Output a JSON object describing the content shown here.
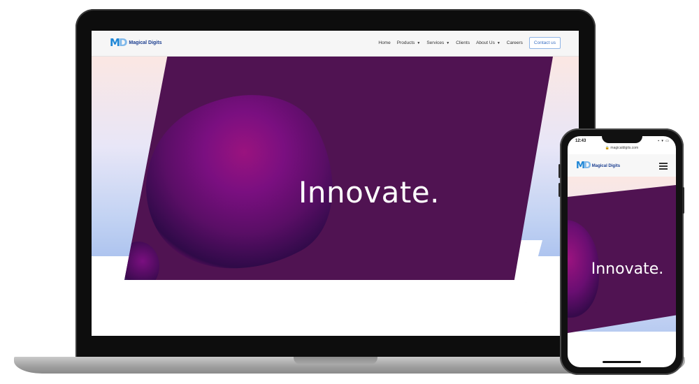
{
  "desktop": {
    "logo": {
      "mark_m": "M",
      "mark_d": "D",
      "text": "Magical Digits"
    },
    "nav": [
      {
        "label": "Home",
        "dropdown": false
      },
      {
        "label": "Products",
        "dropdown": true
      },
      {
        "label": "Services",
        "dropdown": true
      },
      {
        "label": "Clients",
        "dropdown": false
      },
      {
        "label": "About Us",
        "dropdown": true
      },
      {
        "label": "Careers",
        "dropdown": false
      }
    ],
    "contact_label": "Contact us",
    "hero_text": "Innovate.",
    "caret": "▼"
  },
  "mobile": {
    "time": "12:43",
    "status_icons": "▪ ▾ ▭",
    "url": "🔒 magicaldigits.com",
    "logo": {
      "mark_m": "M",
      "mark_d": "D",
      "text": "Magical Digits"
    },
    "hero_text": "Innovate."
  },
  "colors": {
    "hero_panel": "#501352",
    "brand_blue": "#1e86d6",
    "logo_text": "#1a3d8f",
    "contact_border": "#8fb4e6"
  },
  "icons": [
    "hamburger-menu-icon",
    "lock-icon",
    "caret-down-icon"
  ]
}
